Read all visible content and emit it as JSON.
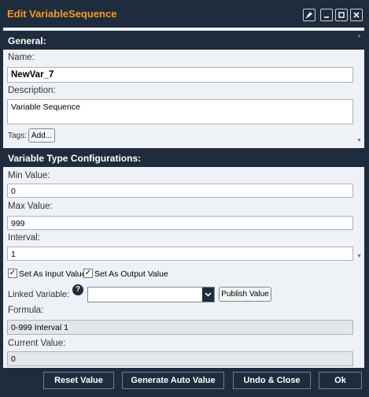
{
  "window": {
    "title": "Edit VariableSequence"
  },
  "general": {
    "header": "General:",
    "name_label": "Name:",
    "name_value": "NewVar_7",
    "description_label": "Description:",
    "description_value": "Variable Sequence",
    "tags_label": "Tags:",
    "tags_add": "Add..."
  },
  "config": {
    "header": "Variable Type Configurations:",
    "min_label": "Min Value:",
    "min_value": "0",
    "max_label": "Max Value:",
    "max_value": "999",
    "interval_label": "Interval:",
    "interval_value": "1",
    "set_input_label": "Set As Input Value",
    "set_input_checked": true,
    "set_output_label": "Set As Output Value",
    "set_output_checked": true,
    "linked_label": "Linked Variable:",
    "linked_value": "",
    "publish_label": "Publish Value",
    "formula_label": "Formula:",
    "formula_value": "0-999 Interval 1",
    "current_label": "Current Value:",
    "current_value": "0"
  },
  "footer": {
    "reset": "Reset Value",
    "generate": "Generate Auto Value",
    "undo": "Undo & Close",
    "ok": "Ok"
  },
  "colors": {
    "title": "#f39a1e",
    "frame": "#1e2c3d",
    "panel": "#eef2f7"
  }
}
